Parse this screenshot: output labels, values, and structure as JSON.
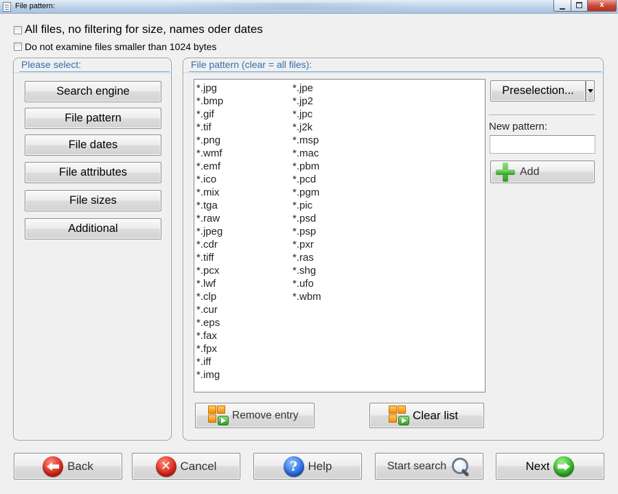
{
  "window": {
    "title": "File pattern:",
    "controls": {
      "minimize": "",
      "maximize": "",
      "close": "x"
    }
  },
  "options": {
    "all_files_label": "All files, no filtering for size, names oder dates",
    "min_size_label": "Do not examine files smaller than 1024 bytes"
  },
  "left_panel": {
    "header": "Please select:",
    "items": [
      {
        "label": "Search engine"
      },
      {
        "label": "File pattern"
      },
      {
        "label": "File dates"
      },
      {
        "label": "File attributes"
      },
      {
        "label": "File sizes"
      },
      {
        "label": "Additional"
      }
    ]
  },
  "right_panel": {
    "header": "File pattern (clear = all files):",
    "patterns_col1": [
      "*.jpg",
      "*.bmp",
      "*.gif",
      "*.tif",
      "*.png",
      "*.wmf",
      "*.emf",
      "*.ico",
      "*.mix",
      "*.tga",
      "*.raw",
      "*.jpeg",
      "*.cdr",
      "*.tiff",
      "*.pcx",
      "*.lwf",
      "*.clp",
      "*.cur",
      "*.eps",
      "*.fax",
      "*.fpx",
      "*.iff",
      "*.img"
    ],
    "patterns_col2": [
      "*.jpe",
      "*.jp2",
      "*.jpc",
      "*.j2k",
      "*.msp",
      "*.mac",
      "*.pbm",
      "*.pcd",
      "*.pgm",
      "*.pic",
      "*.psd",
      "*.psp",
      "*.pxr",
      "*.ras",
      "*.shg",
      "*.ufo",
      "*.wbm"
    ],
    "preselection_label": "Preselection...",
    "new_pattern_label": "New pattern:",
    "new_pattern_value": "",
    "add_label": "Add",
    "remove_label": "Remove entry",
    "clear_label": "Clear list"
  },
  "footer": {
    "back_label": "Back",
    "cancel_label": "Cancel",
    "help_label": "Help",
    "start_label": "Start search",
    "next_label": "Next"
  },
  "icons": {
    "back": "back-arrow-icon",
    "cancel": "cancel-x-icon",
    "help": "help-question-icon",
    "start": "magnifier-icon",
    "next": "next-arrow-icon",
    "add": "plus-icon",
    "remove": "blocks-icon",
    "clear": "blocks-icon"
  },
  "colors": {
    "header_text": "#2f6fb0",
    "add_plus": "#2f9a25",
    "close_button": "#c74632"
  }
}
